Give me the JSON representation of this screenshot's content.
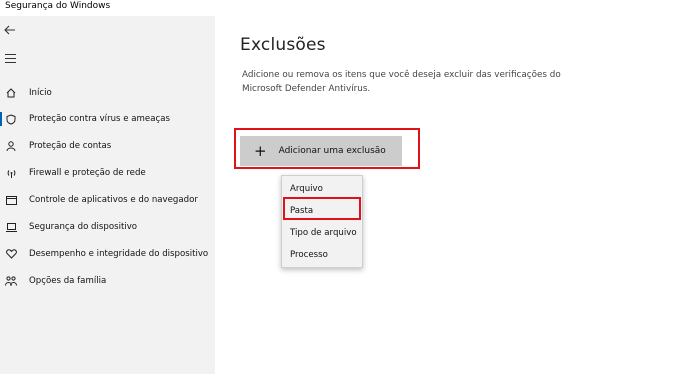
{
  "window": {
    "title": "Segurança do Windows"
  },
  "sidebar": {
    "items": [
      {
        "label": "Início",
        "icon": "home-icon"
      },
      {
        "label": "Proteção contra vírus e ameaças",
        "icon": "shield-icon",
        "active": true
      },
      {
        "label": "Proteção de contas",
        "icon": "person-icon"
      },
      {
        "label": "Firewall e proteção de rede",
        "icon": "wifi-antenna-icon"
      },
      {
        "label": "Controle de aplicativos e do navegador",
        "icon": "browser-window-icon"
      },
      {
        "label": "Segurança do dispositivo",
        "icon": "laptop-icon"
      },
      {
        "label": "Desempenho e integridade do dispositivo",
        "icon": "heart-icon"
      },
      {
        "label": "Opções da família",
        "icon": "family-icon"
      }
    ]
  },
  "main": {
    "title": "Exclusões",
    "description": "Adicione ou remova os itens que você deseja excluir das verificações do Microsoft Defender Antivírus.",
    "add_button": {
      "label": "Adicionar uma exclusão",
      "icon": "plus-icon"
    },
    "dropdown": {
      "items": [
        {
          "label": "Arquivo"
        },
        {
          "label": "Pasta"
        },
        {
          "label": "Tipo de arquivo"
        },
        {
          "label": "Processo"
        }
      ],
      "highlighted": "Pasta"
    }
  },
  "colors": {
    "sidebar_bg": "#f2f2f2",
    "accent": "#0063b1",
    "highlight_red": "#e0111a",
    "button_bg": "#cccccc"
  }
}
